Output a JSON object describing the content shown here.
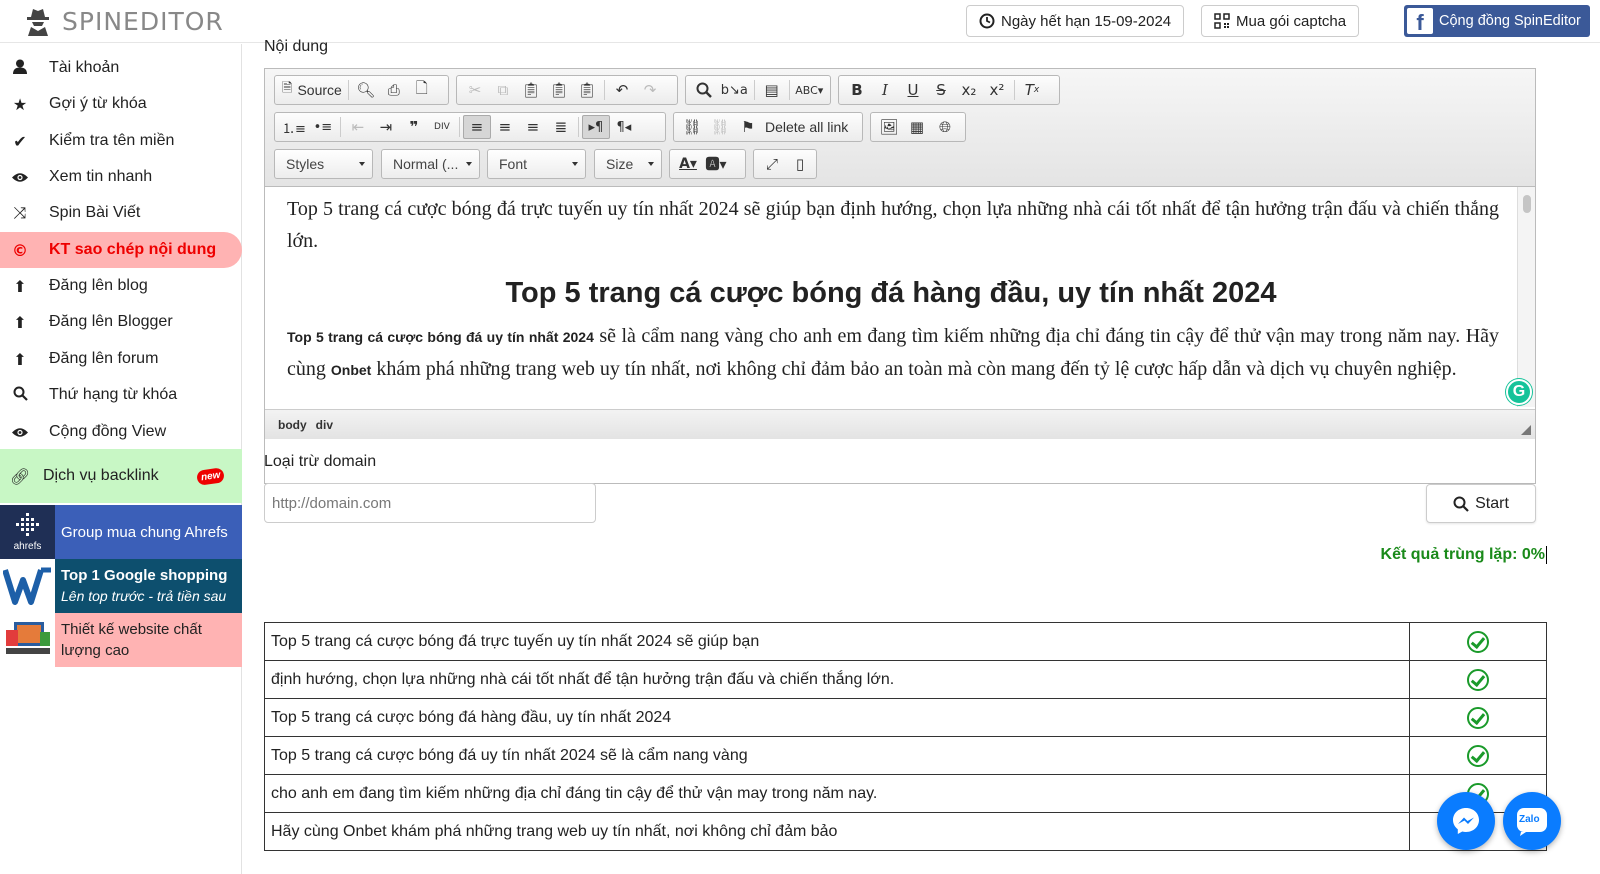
{
  "app": {
    "name": "SPINEDITOR"
  },
  "header": {
    "expiry_label": "Ngày hết hạn 15-09-2024",
    "captcha_label": "Mua gói captcha",
    "community_label": "Cộng đồng SpinEditor"
  },
  "sidebar": {
    "items": [
      {
        "label": "Tài khoản",
        "icon": "user-icon"
      },
      {
        "label": "Gợi ý từ khóa",
        "icon": "star-icon"
      },
      {
        "label": "Kiểm tra tên miền",
        "icon": "check-icon"
      },
      {
        "label": "Xem tin nhanh",
        "icon": "eye-icon"
      },
      {
        "label": "Spin Bài Viết",
        "icon": "shuffle-icon"
      },
      {
        "label": "KT sao chép nội dung",
        "icon": "copyright-icon",
        "active": true
      },
      {
        "label": "Đăng lên blog",
        "icon": "upload-icon"
      },
      {
        "label": "Đăng lên Blogger",
        "icon": "upload-icon"
      },
      {
        "label": "Đăng lên forum",
        "icon": "upload-icon"
      },
      {
        "label": "Thứ hạng từ khóa",
        "icon": "search-icon"
      },
      {
        "label": "Cộng đồng View",
        "icon": "eye-icon"
      }
    ],
    "backlink": {
      "label": "Dịch vụ backlink",
      "badge": "new"
    },
    "promos": [
      {
        "label": "Group mua chung Ahrefs",
        "thumb_text": "ahrefs"
      },
      {
        "label": "Top 1 Google shopping",
        "sub": "Lên top trước - trả tiền sau"
      },
      {
        "label": "Thiết kế website chất lượng cao"
      }
    ]
  },
  "editor": {
    "label": "Nội dung",
    "source_label": "Source",
    "delete_links_label": "Delete all link",
    "combos": {
      "styles": "Styles",
      "format": "Normal (...",
      "font": "Font",
      "size": "Size"
    },
    "content": {
      "intro": "Top 5 trang cá cược bóng đá trực tuyến uy tín nhất 2024 sẽ giúp bạn định hướng, chọn lựa những nhà cái tốt nhất để tận hưởng trận đấu và chiến thắng lớn.",
      "heading": "Top 5 trang cá cược bóng đá hàng đầu, uy tín nhất 2024",
      "p2_bold": "Top 5 trang cá cược bóng đá uy tín nhất 2024",
      "p2_text": " sẽ là cẩm nang vàng cho anh em đang tìm kiếm những địa chỉ đáng tin cậy để thử vận may trong năm nay. Hãy cùng ",
      "p2_brand": "Onbet",
      "p2_rest": " khám phá những trang web uy tín nhất, nơi không chỉ đảm bảo an toàn mà còn mang đến tỷ lệ cược hấp dẫn và dịch vụ chuyên nghiệp."
    },
    "path": [
      "body",
      "div"
    ]
  },
  "exclude": {
    "label": "Loại trừ domain",
    "placeholder": "http://domain.com",
    "start_label": "Start"
  },
  "result": {
    "label": "Kết quả trùng lặp: 0%"
  },
  "rows": [
    "Top 5 trang cá cược bóng đá trực tuyến uy tín nhất 2024 sẽ giúp bạn",
    "định hướng, chọn lựa những nhà cái tốt nhất để tận hưởng trận đấu và chiến thắng lớn.",
    "Top 5 trang cá cược bóng đá hàng đầu, uy tín nhất 2024",
    "Top 5 trang cá cược bóng đá uy tín nhất 2024 sẽ là cẩm nang vàng",
    "cho anh em đang tìm kiếm những địa chỉ đáng tin cậy để thử vận may trong năm nay.",
    "Hãy cùng Onbet khám phá những trang web uy tín nhất, nơi không chỉ đảm bảo"
  ],
  "chat": {
    "zalo_label": "Zalo"
  },
  "colors": {
    "active": "#ffb3b3",
    "accent_red": "#e00000",
    "result_green": "#1a8a1a",
    "facebook": "#3b5998",
    "ahrefs_bg": "#3b5fb8",
    "shopping_bg": "#0d4f6e"
  }
}
